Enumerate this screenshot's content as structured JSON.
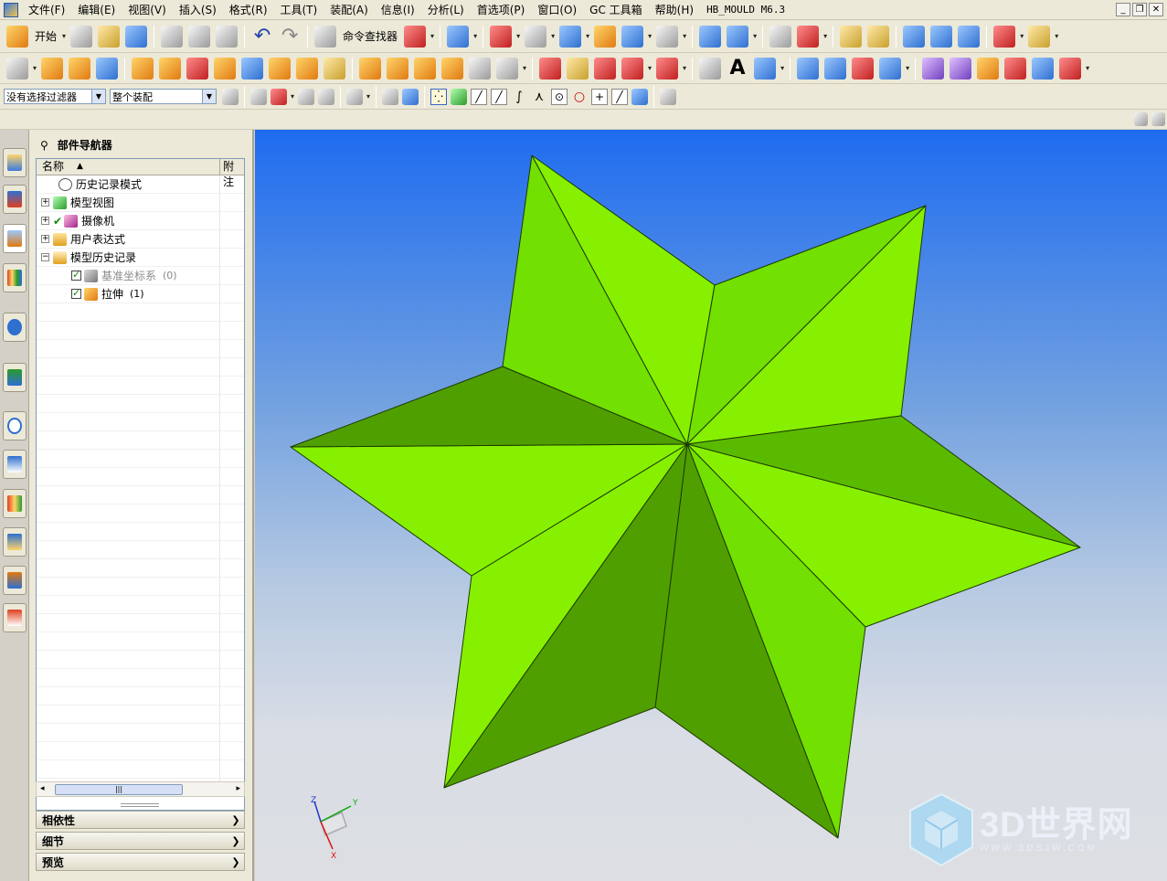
{
  "menubar": {
    "items": [
      "文件(F)",
      "编辑(E)",
      "视图(V)",
      "插入(S)",
      "格式(R)",
      "工具(T)",
      "装配(A)",
      "信息(I)",
      "分析(L)",
      "首选项(P)",
      "窗口(O)",
      "GC 工具箱",
      "帮助(H)",
      "HB_MOULD M6.3"
    ]
  },
  "toolbar": {
    "start_label": "开始",
    "command_finder_label": "命令查找器"
  },
  "selection_bar": {
    "filter_value": "没有选择过滤器",
    "scope_value": "整个装配"
  },
  "navigator": {
    "title": "部件导航器",
    "col_name": "名称",
    "col_attach": "附注",
    "rows": [
      {
        "label": "历史记录模式",
        "count": ""
      },
      {
        "label": "模型视图",
        "count": ""
      },
      {
        "label": "摄像机",
        "count": ""
      },
      {
        "label": "用户表达式",
        "count": ""
      },
      {
        "label": "模型历史记录",
        "count": ""
      },
      {
        "label": "基准坐标系",
        "count": "(0)"
      },
      {
        "label": "拉伸",
        "count": "(1)"
      }
    ],
    "panels": [
      "相依性",
      "细节",
      "预览"
    ]
  },
  "viewport": {
    "axis_x": "X",
    "axis_y": "Y",
    "axis_z": "Z",
    "star_colors": {
      "light": "#86f000",
      "mid": "#72e000",
      "dark": "#5aba00",
      "darker": "#4f9f00",
      "edge": "#1d3a00"
    }
  },
  "watermark": {
    "big": "3D世界网",
    "small": "WWW.3DSJW.COM"
  }
}
